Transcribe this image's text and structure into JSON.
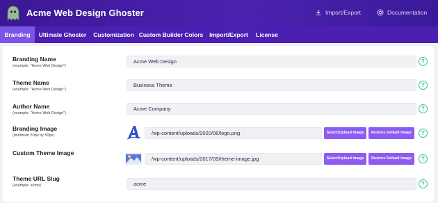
{
  "app": {
    "title": "Acme Web Design Ghoster",
    "links": {
      "import_export": "Import/Export",
      "documentation": "Documentation"
    }
  },
  "tabs": [
    {
      "label": "Branding",
      "active": true
    },
    {
      "label": "Ultimate Ghoster",
      "active": false
    },
    {
      "label": "Customization",
      "active": false
    },
    {
      "label": "Custom Builder Colors",
      "active": false
    },
    {
      "label": "Import/Export",
      "active": false
    },
    {
      "label": "License",
      "active": false
    }
  ],
  "fields": {
    "branding_name": {
      "label": "Branding Name",
      "hint": "(example: \"Acme Web Design\")",
      "value": "Acme Web Design"
    },
    "theme_name": {
      "label": "Theme Name",
      "hint": "(example: \"Acme Web Design\")",
      "value": "Business Theme"
    },
    "author_name": {
      "label": "Author Name",
      "hint": "(example: \"Acme Web Design\")",
      "value": "Acme Company"
    },
    "branding_image": {
      "label": "Branding Image",
      "hint": "(minimum 50px by 50px)",
      "value": "/wp-content/uploads/2020/06/logo.png"
    },
    "custom_theme_image": {
      "label": "Custom Theme Image",
      "hint": "",
      "value": "/wp-content/uploads/2017/09/theme-image.jpg"
    },
    "theme_url_slug": {
      "label": "Theme URL Slug",
      "hint": "(example: acme)",
      "value": "acme"
    }
  },
  "buttons": {
    "select_upload": "Select/Upload Image",
    "restore_default": "Restore Default Image"
  },
  "help_glyph": "?",
  "colors": {
    "header": "#3b1896",
    "tab_active": "#7b55e6",
    "button": "#8c5cf0",
    "help": "#2fbfa0"
  }
}
